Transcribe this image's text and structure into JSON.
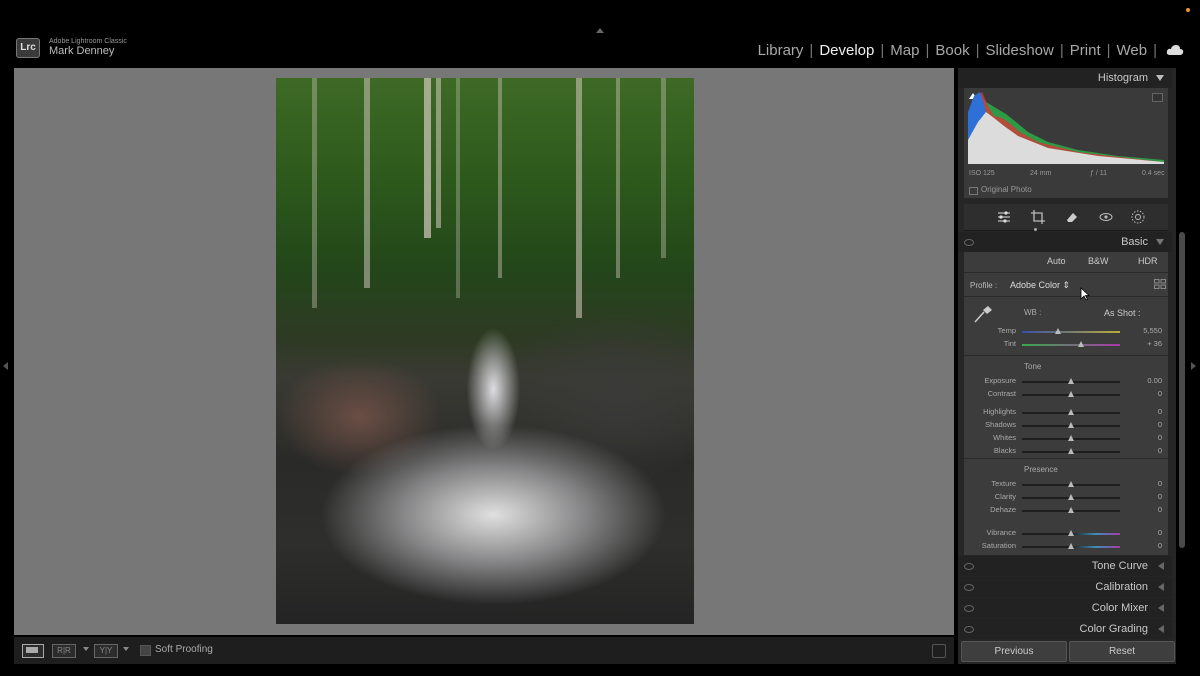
{
  "app": {
    "name": "Adobe Lightroom Classic",
    "logo": "Lrc",
    "user": "Mark Denney"
  },
  "modules": [
    "Library",
    "Develop",
    "Map",
    "Book",
    "Slideshow",
    "Print",
    "Web"
  ],
  "active_module": "Develop",
  "histogram": {
    "label": "Histogram",
    "iso": "ISO 125",
    "focal": "24 mm",
    "aperture": "ƒ / 11",
    "shutter": "0.4 sec",
    "original_photo_label": "Original Photo"
  },
  "tools": [
    "sliders-icon",
    "crop-icon",
    "eraser-icon",
    "redeye-icon",
    "masking-icon"
  ],
  "basic": {
    "label": "Basic",
    "buttons": {
      "auto": "Auto",
      "bw": "B&W",
      "hdr": "HDR"
    },
    "profile_label": "Profile :",
    "profile_value": "Adobe Color ⇕",
    "wb_label": "WB :",
    "wb_value": "As Shot :",
    "temp": {
      "label": "Temp",
      "value": "5,550",
      "position": 0.37
    },
    "tint": {
      "label": "Tint",
      "value": "+ 36",
      "position": 0.6
    },
    "tone_label": "Tone",
    "tone": [
      {
        "label": "Exposure",
        "value": "0.00",
        "position": 0.5
      },
      {
        "label": "Contrast",
        "value": "0",
        "position": 0.5
      },
      {
        "label": "Highlights",
        "value": "0",
        "position": 0.5
      },
      {
        "label": "Shadows",
        "value": "0",
        "position": 0.5
      },
      {
        "label": "Whites",
        "value": "0",
        "position": 0.5
      },
      {
        "label": "Blacks",
        "value": "0",
        "position": 0.5
      }
    ],
    "presence_label": "Presence",
    "presence": [
      {
        "label": "Texture",
        "value": "0",
        "position": 0.5
      },
      {
        "label": "Clarity",
        "value": "0",
        "position": 0.5
      },
      {
        "label": "Dehaze",
        "value": "0",
        "position": 0.5
      },
      {
        "label": "Vibrance",
        "value": "0",
        "position": 0.5
      },
      {
        "label": "Saturation",
        "value": "0",
        "position": 0.5
      }
    ]
  },
  "collapsed_panels": [
    "Tone Curve",
    "Calibration",
    "Color Mixer",
    "Color Grading"
  ],
  "footer": {
    "previous": "Previous",
    "reset": "Reset"
  },
  "filmstrip": {
    "soft_proofing": "Soft Proofing"
  },
  "colors": {
    "accent_orange": "#e8962a",
    "panel_bg": "#262626",
    "canvas_bg": "#777777"
  }
}
